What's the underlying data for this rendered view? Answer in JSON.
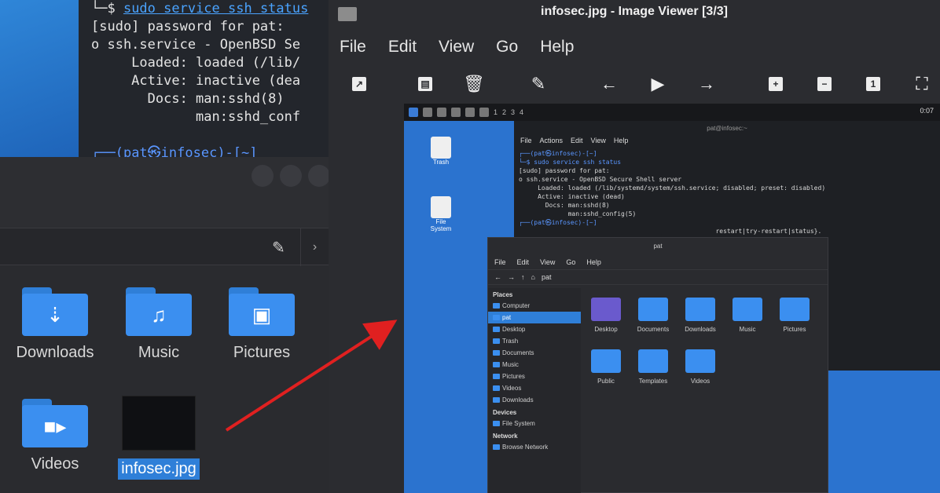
{
  "terminal": {
    "lines": [
      {
        "prefix": "└─$ ",
        "cmd": "sudo service ssh status"
      },
      {
        "text": "[sudo] password for pat:"
      },
      {
        "text": "o ssh.service - OpenBSD Se"
      },
      {
        "text": "     Loaded: loaded (/lib/"
      },
      {
        "text": "     Active: inactive (dea"
      },
      {
        "text": "       Docs: man:sshd(8)"
      },
      {
        "text": "             man:sshd_conf"
      }
    ],
    "prompt": {
      "open": "┌──(",
      "user": "pat㉿infosec",
      "close": ")-[~]"
    }
  },
  "filemanager": {
    "items": [
      {
        "label": "Downloads",
        "icon": "download-icon"
      },
      {
        "label": "Music",
        "icon": "music-note-icon"
      },
      {
        "label": "Pictures",
        "icon": "picture-icon"
      },
      {
        "label": "Videos",
        "icon": "video-camera-icon"
      },
      {
        "label": "infosec.jpg",
        "icon": "image-thumbnail",
        "selected": true
      }
    ]
  },
  "viewer": {
    "title": "infosec.jpg - Image Viewer [3/3]",
    "menu": [
      "File",
      "Edit",
      "View",
      "Go",
      "Help"
    ],
    "toolbar": [
      "open-icon",
      "save-icon",
      "delete-icon",
      "edit-icon",
      "back-arrow-icon",
      "play-icon",
      "forward-arrow-icon",
      "zoom-in-icon",
      "zoom-out-icon",
      "actual-size-icon",
      "fullscreen-icon"
    ]
  },
  "inner": {
    "panel_workspaces": [
      "1",
      "2",
      "3",
      "4"
    ],
    "panel_clock": "0:07",
    "desktop_icons": [
      "Trash",
      "File System"
    ],
    "term_title": "pat@infosec:~",
    "term_menu": [
      "File",
      "Actions",
      "Edit",
      "View",
      "Help"
    ],
    "term_lines": [
      {
        "text": "┌──(pat㉿infosec)-[~]",
        "blue": true
      },
      {
        "text": "└─$ sudo service ssh status",
        "blue": true
      },
      {
        "text": "[sudo] password for pat:"
      },
      {
        "text": "o ssh.service - OpenBSD Secure Shell server"
      },
      {
        "text": "     Loaded: loaded (/lib/systemd/system/ssh.service; disabled; preset: disabled)"
      },
      {
        "text": "     Active: inactive (dead)"
      },
      {
        "text": "       Docs: man:sshd(8)"
      },
      {
        "text": "             man:sshd_config(5)"
      },
      {
        "text": ""
      },
      {
        "text": "┌──(pat㉿infosec)-[~]",
        "blue": true
      },
      {
        "text": "                                                    restart|try-restart|status}."
      }
    ],
    "fm_title": "pat",
    "fm_menu": [
      "File",
      "Edit",
      "View",
      "Go",
      "Help"
    ],
    "fm_path": "pat",
    "sidebar": [
      {
        "heading": "Places"
      },
      {
        "item": "Computer"
      },
      {
        "item": "pat",
        "selected": true
      },
      {
        "item": "Desktop"
      },
      {
        "item": "Trash"
      },
      {
        "item": "Documents"
      },
      {
        "item": "Music"
      },
      {
        "item": "Pictures"
      },
      {
        "item": "Videos"
      },
      {
        "item": "Downloads"
      },
      {
        "heading": "Devices"
      },
      {
        "item": "File System"
      },
      {
        "heading": "Network"
      },
      {
        "item": "Browse Network"
      }
    ],
    "folders": [
      "Desktop",
      "Documents",
      "Downloads",
      "Music",
      "Pictures",
      "Public",
      "Templates",
      "Videos"
    ]
  },
  "colors": {
    "accent": "#2f7fd8",
    "arrow": "#e02020",
    "desktop": "#2b73cf"
  }
}
